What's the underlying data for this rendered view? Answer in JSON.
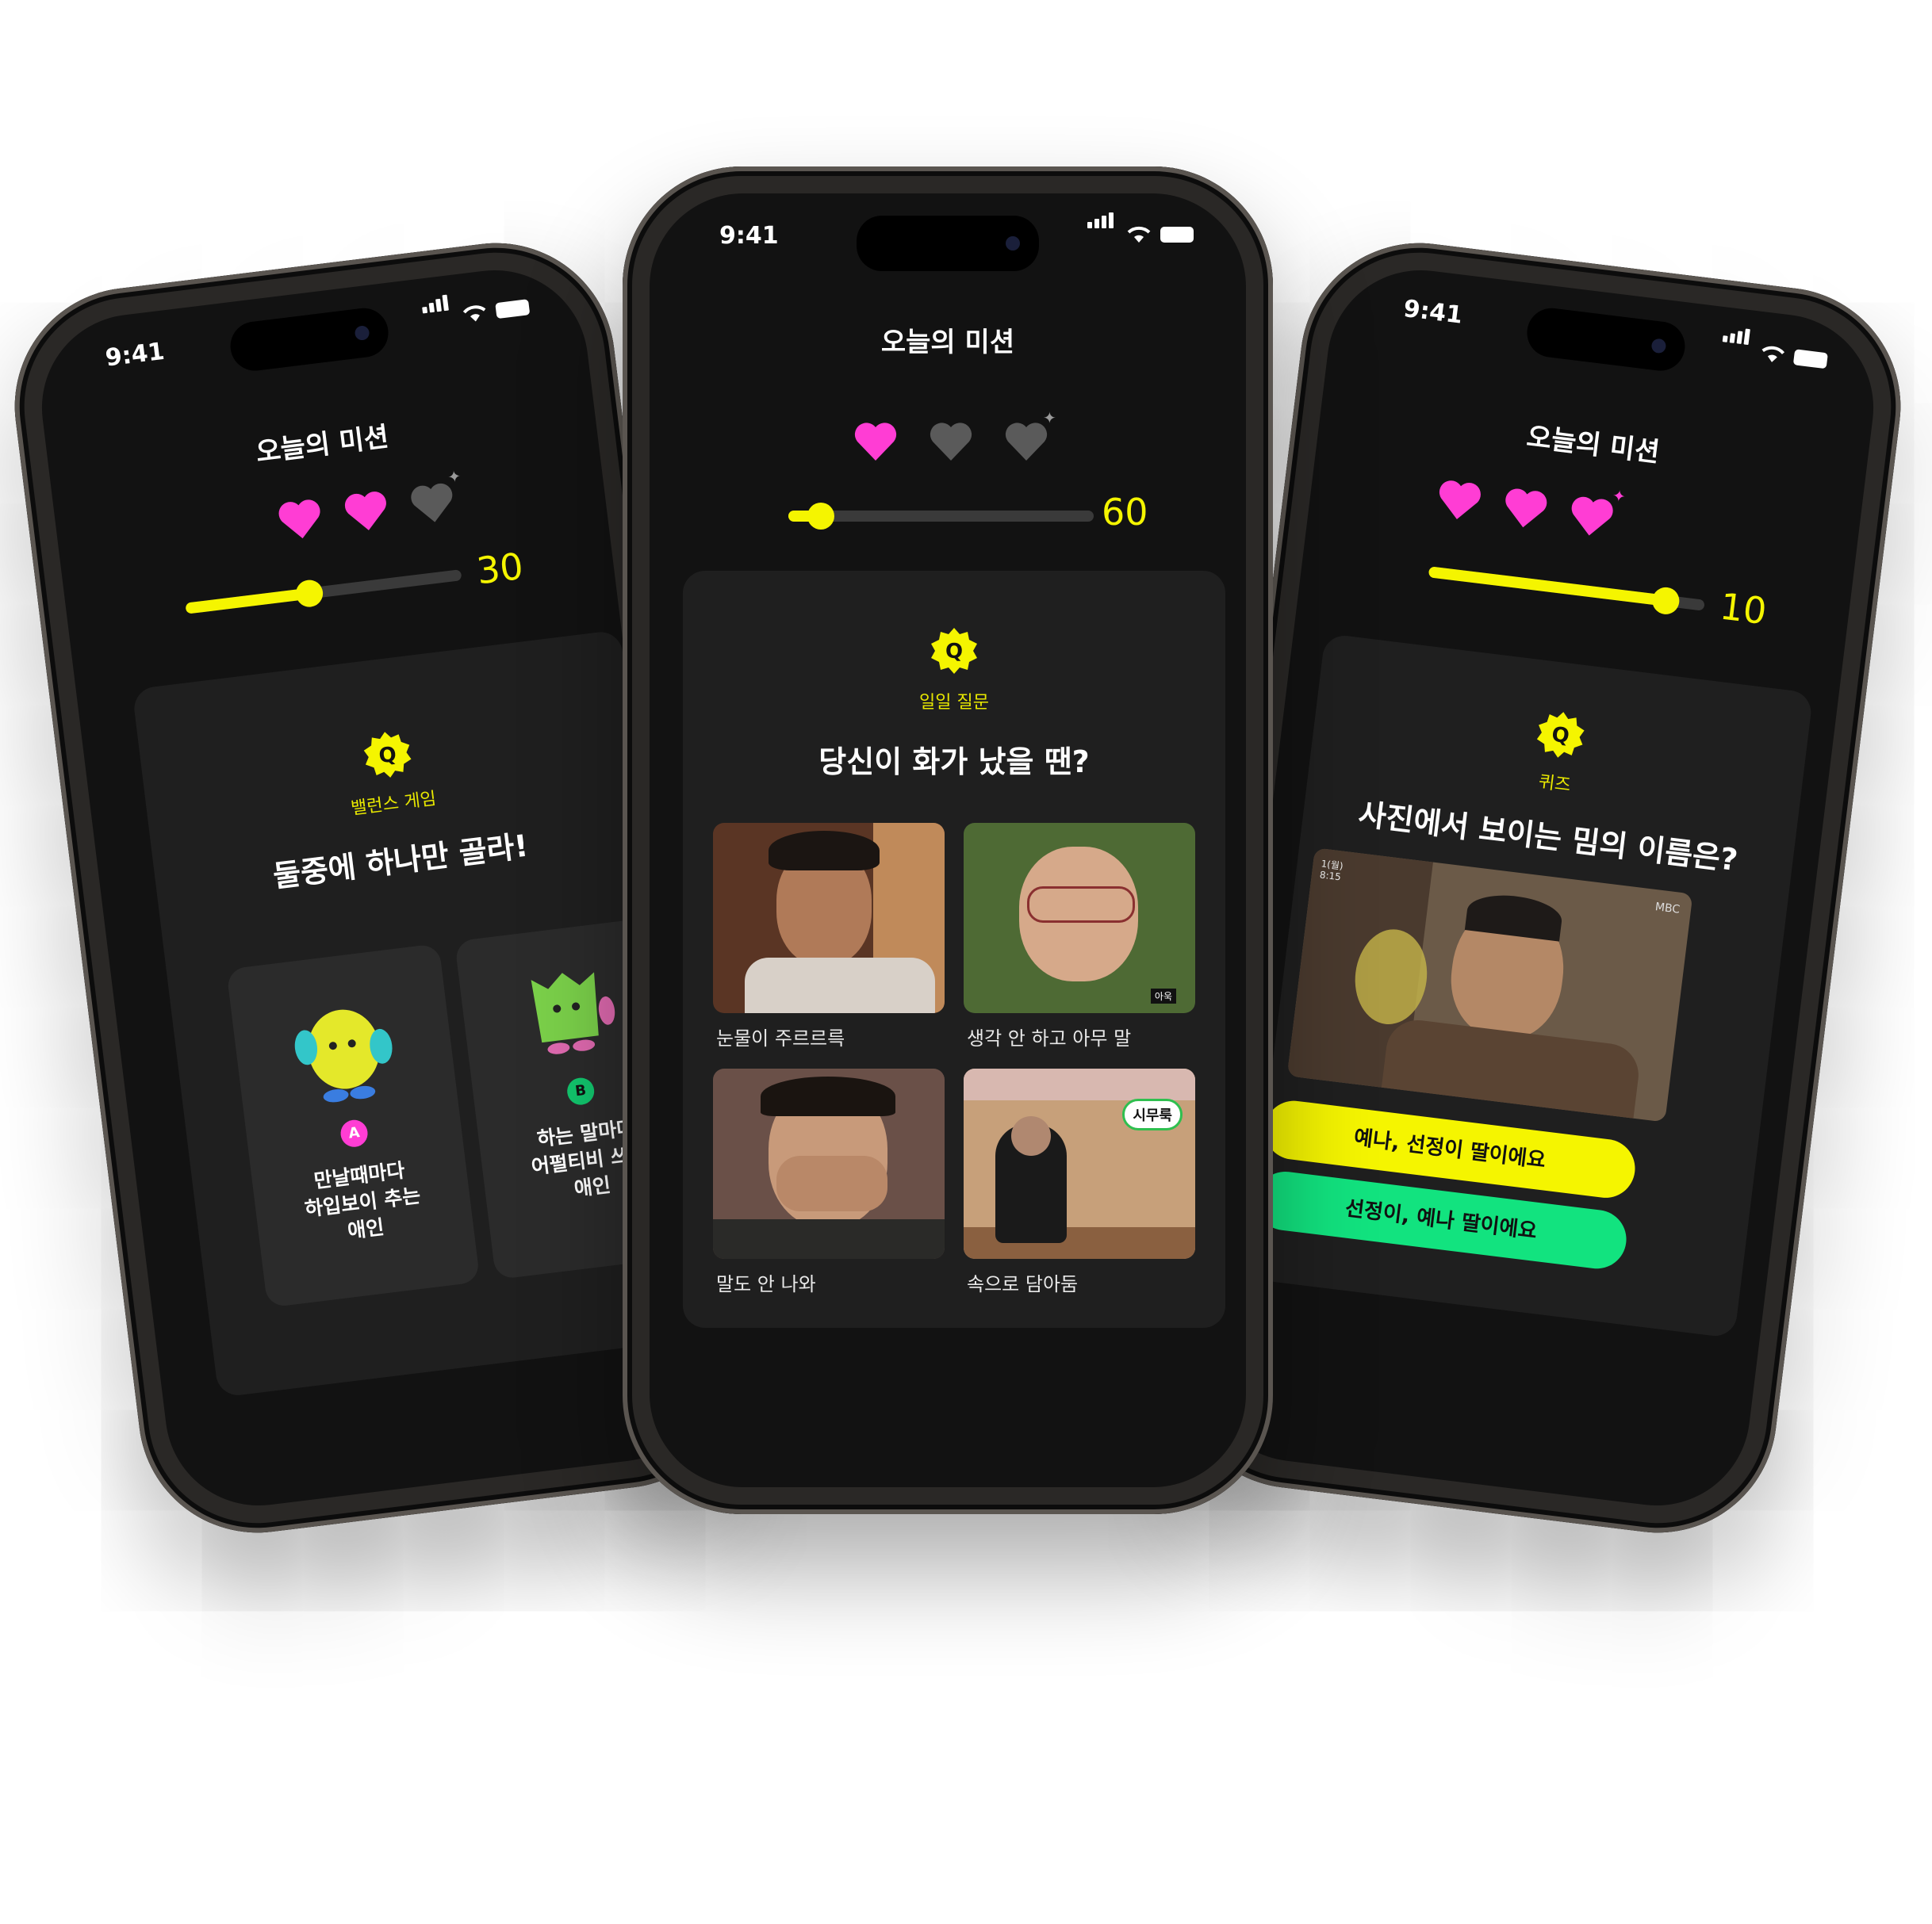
{
  "colors": {
    "accent_yellow": "#F5F500",
    "heart_pink": "#FF3DD4",
    "heart_gray": "#5A5A5A",
    "answer_green": "#12E37F",
    "badge_a": "#FF3DD4",
    "badge_b": "#12C76E"
  },
  "phones": {
    "left": {
      "time": "9:41",
      "title": "오늘의 미션",
      "hearts": [
        "filled",
        "filled",
        "empty"
      ],
      "progress_fraction": 0.45,
      "progress_number": "30",
      "mission_type": "밸런스 게임",
      "question": "둘중에 하나만 골라!",
      "options": [
        {
          "badge": "A",
          "lines": [
            "만날때마다",
            "하입보이 추는",
            "애인"
          ]
        },
        {
          "badge": "B",
          "lines": [
            "하는 말마다",
            "어펄티비 쓰는",
            "애인"
          ]
        }
      ]
    },
    "center": {
      "time": "9:41",
      "title": "오늘의 미션",
      "hearts": [
        "filled",
        "empty",
        "empty"
      ],
      "progress_fraction": 0.1,
      "progress_number": "60",
      "mission_type": "일일 질문",
      "question": "당신이 화가 났을 땐?",
      "choices": [
        {
          "caption": "눈물이 주르르륵"
        },
        {
          "caption": "생각 안 하고 아무 말",
          "tag": "아욱"
        },
        {
          "caption": "말도 안 나와"
        },
        {
          "caption": "속으로 담아둠",
          "tag": "시무룩"
        }
      ]
    },
    "right": {
      "time": "9:41",
      "title": "오늘의 미션",
      "hearts": [
        "filled",
        "filled",
        "filled"
      ],
      "progress_fraction": 0.86,
      "progress_number": "10",
      "mission_type": "퀴즈",
      "question": "사진에서 보이는 밈의 이름은?",
      "image_tags": {
        "channel": "MBC",
        "corner": "1(월) 8:15"
      },
      "answers": [
        "예나, 선정이 딸이에요",
        "선정이, 예나 딸이에요"
      ]
    }
  }
}
